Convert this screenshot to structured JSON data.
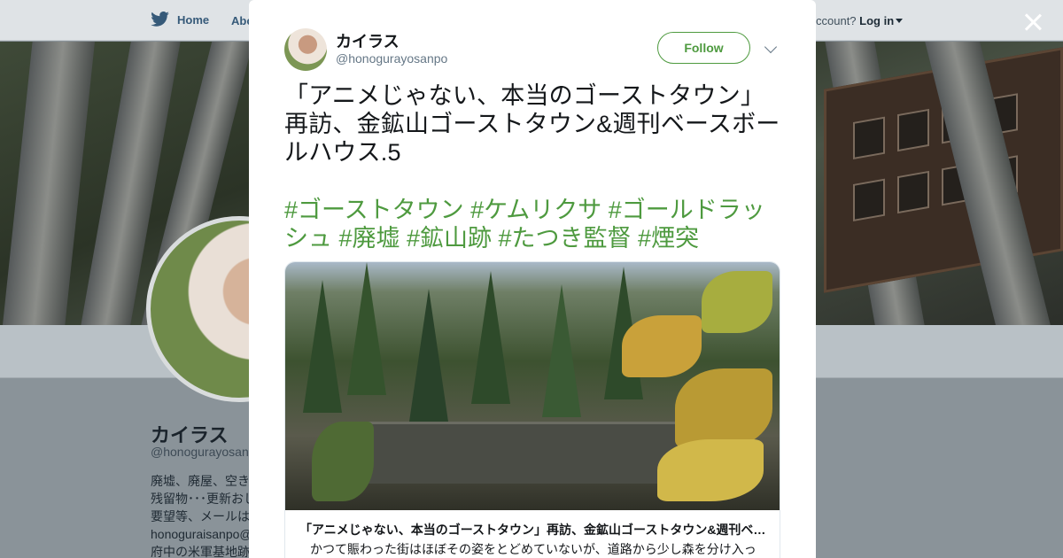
{
  "nav": {
    "home_label": "Home",
    "about_label": "Abo",
    "account_prompt": "ccount?",
    "login_label": "Log in"
  },
  "profile": {
    "name": "カイラス",
    "handle": "@honogurayosanpo",
    "bio_lines": [
      "廃墟、廃屋、空き",
      "残留物･･･更新おし",
      "要望等、メールは",
      "honoguraisanpo@",
      "府中の米軍基地跡"
    ]
  },
  "tweet": {
    "author_name": "カイラス",
    "author_handle": "@honogurayosanpo",
    "follow_label": "Follow",
    "text": "「アニメじゃない、本当のゴーストタウン」再訪、金鉱山ゴーストタウン&週刊ベースボールハウス.5",
    "hashtags": "#ゴーストタウン #ケムリクサ #ゴールドラッシュ #廃墟 #鉱山跡 #たつき監督 #煙突",
    "card": {
      "title": "「アニメじゃない、本当のゴーストタウン」再訪、金鉱山ゴーストタウン&週刊ベ…",
      "description": "かつて賑わった街はほぼその姿をとどめていないが、道路から少し森を分け入っ"
    }
  },
  "colors": {
    "accent": "#4e9a3f",
    "overlay": "#8a9399"
  },
  "icons": {
    "logo": "bird-icon",
    "close": "close-icon",
    "menu": "chevron-down-icon"
  }
}
